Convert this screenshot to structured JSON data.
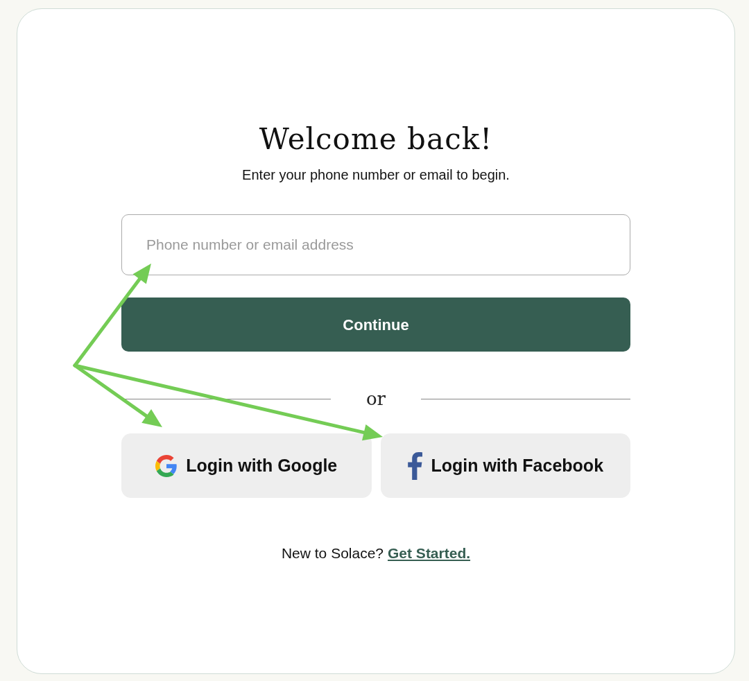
{
  "title": "Welcome back!",
  "subtitle": "Enter your phone number or email to begin.",
  "input": {
    "placeholder": "Phone number or email address"
  },
  "continue_button": "Continue",
  "divider": "or",
  "social_buttons": [
    {
      "kind": "google",
      "label": "Login with Google"
    },
    {
      "kind": "facebook",
      "label": "Login with Facebook"
    }
  ],
  "footer": {
    "text": "New to Solace?",
    "link": "Get Started."
  }
}
